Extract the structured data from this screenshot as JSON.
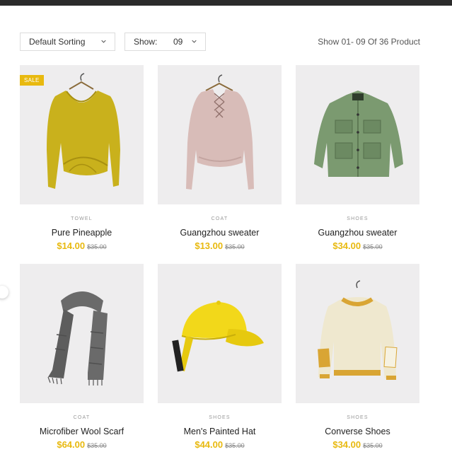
{
  "toolbar": {
    "sort_label": "Default Sorting",
    "show_label": "Show:",
    "show_value": "09",
    "result_text": "Show 01- 09 Of 36 Product"
  },
  "products": [
    {
      "category": "TOWEL",
      "name": "Pure Pineapple",
      "price": "$14.00",
      "old_price": "$35.00",
      "badge": "SALE",
      "image": "mustard-twist-sweater",
      "color": "#c9b11c"
    },
    {
      "category": "COAT",
      "name": "Guangzhou sweater",
      "price": "$13.00",
      "old_price": "$35.00",
      "image": "pink-lace-up-sweater",
      "color": "#d8bcb8"
    },
    {
      "category": "SHOES",
      "name": "Guangzhou sweater",
      "price": "$34.00",
      "old_price": "$35.00",
      "image": "green-utility-jacket",
      "color": "#7b9a70"
    },
    {
      "category": "COAT",
      "name": "Microfiber Wool Scarf",
      "price": "$64.00",
      "old_price": "$35.00",
      "image": "grey-knit-scarf",
      "color": "#6a6a6a"
    },
    {
      "category": "SHOES",
      "name": "Men's Painted Hat",
      "price": "$44.00",
      "old_price": "$35.00",
      "image": "yellow-baseball-cap",
      "color": "#f2d81a"
    },
    {
      "category": "SHOES",
      "name": "Converse Shoes",
      "price": "$34.00",
      "old_price": "$35.00",
      "image": "cream-knit-sweater",
      "color": "#efe8cf"
    }
  ],
  "colors": {
    "accent": "#e8b90f",
    "topbar": "#2b2b2b",
    "image_bg": "#eeedee"
  }
}
